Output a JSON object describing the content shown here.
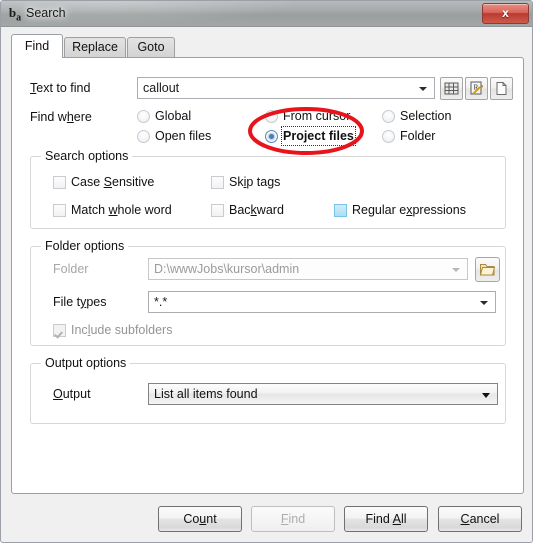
{
  "window": {
    "title": "Search",
    "icon": "ba-icon",
    "close_label": "x"
  },
  "tabs": [
    {
      "label": "Find",
      "active": true
    },
    {
      "label": "Replace",
      "active": false
    },
    {
      "label": "Goto",
      "active": false
    }
  ],
  "find": {
    "text_to_find": {
      "label": "Text to find",
      "accel": "T",
      "value": "callout"
    },
    "tool_buttons": [
      {
        "name": "hash-grid-icon",
        "tooltip": "Insert special character"
      },
      {
        "name": "regex-edit-icon",
        "tooltip": "Edit regular expression"
      },
      {
        "name": "page-icon",
        "tooltip": "New page"
      }
    ],
    "find_where": {
      "label": "Find where",
      "accel": "h",
      "options": [
        {
          "label": "Global",
          "selected": false
        },
        {
          "label": "Open files",
          "selected": false
        },
        {
          "label": "From cursor",
          "selected": false
        },
        {
          "label": "Project files",
          "selected": true
        },
        {
          "label": "Selection",
          "selected": false
        },
        {
          "label": "Folder",
          "selected": false
        }
      ]
    },
    "search_options": {
      "title": "Search options",
      "items": [
        {
          "label": "Case Sensitive",
          "accel": "S",
          "checked": false,
          "hot": false,
          "disabled": false
        },
        {
          "label": "Skip tags",
          "accel": "i",
          "checked": false,
          "hot": false,
          "disabled": false
        },
        {
          "label": "Match whole word",
          "accel": "w",
          "checked": false,
          "hot": false,
          "disabled": false
        },
        {
          "label": "Backward",
          "accel": "k",
          "checked": false,
          "hot": false,
          "disabled": false
        },
        {
          "label": "Regular expressions",
          "accel": "x",
          "checked": false,
          "hot": true,
          "disabled": false
        }
      ]
    },
    "folder_options": {
      "title": "Folder options",
      "folder": {
        "label": "Folder",
        "value": "D:\\wwwJobs\\kursor\\admin",
        "disabled": true
      },
      "file_types": {
        "label": "File types",
        "accel": "y",
        "value": "*.*"
      },
      "include_subfolders": {
        "label": "Include subfolders",
        "accel": "l",
        "checked": true,
        "disabled": true
      },
      "browse_icon": "folder-icon"
    },
    "output_options": {
      "title": "Output options",
      "output": {
        "label": "Output",
        "accel": "O",
        "value": "List all items found"
      }
    }
  },
  "buttons": [
    {
      "label": "Count",
      "accel": "u",
      "disabled": false
    },
    {
      "label": "Find",
      "accel": "F",
      "disabled": true
    },
    {
      "label": "Find All",
      "accel": "A",
      "disabled": false
    },
    {
      "label": "Cancel",
      "accel": "C",
      "disabled": false
    }
  ],
  "annotation": {
    "name": "red-ellipse-highlight",
    "color": "#e8141b",
    "target": "Project files"
  }
}
